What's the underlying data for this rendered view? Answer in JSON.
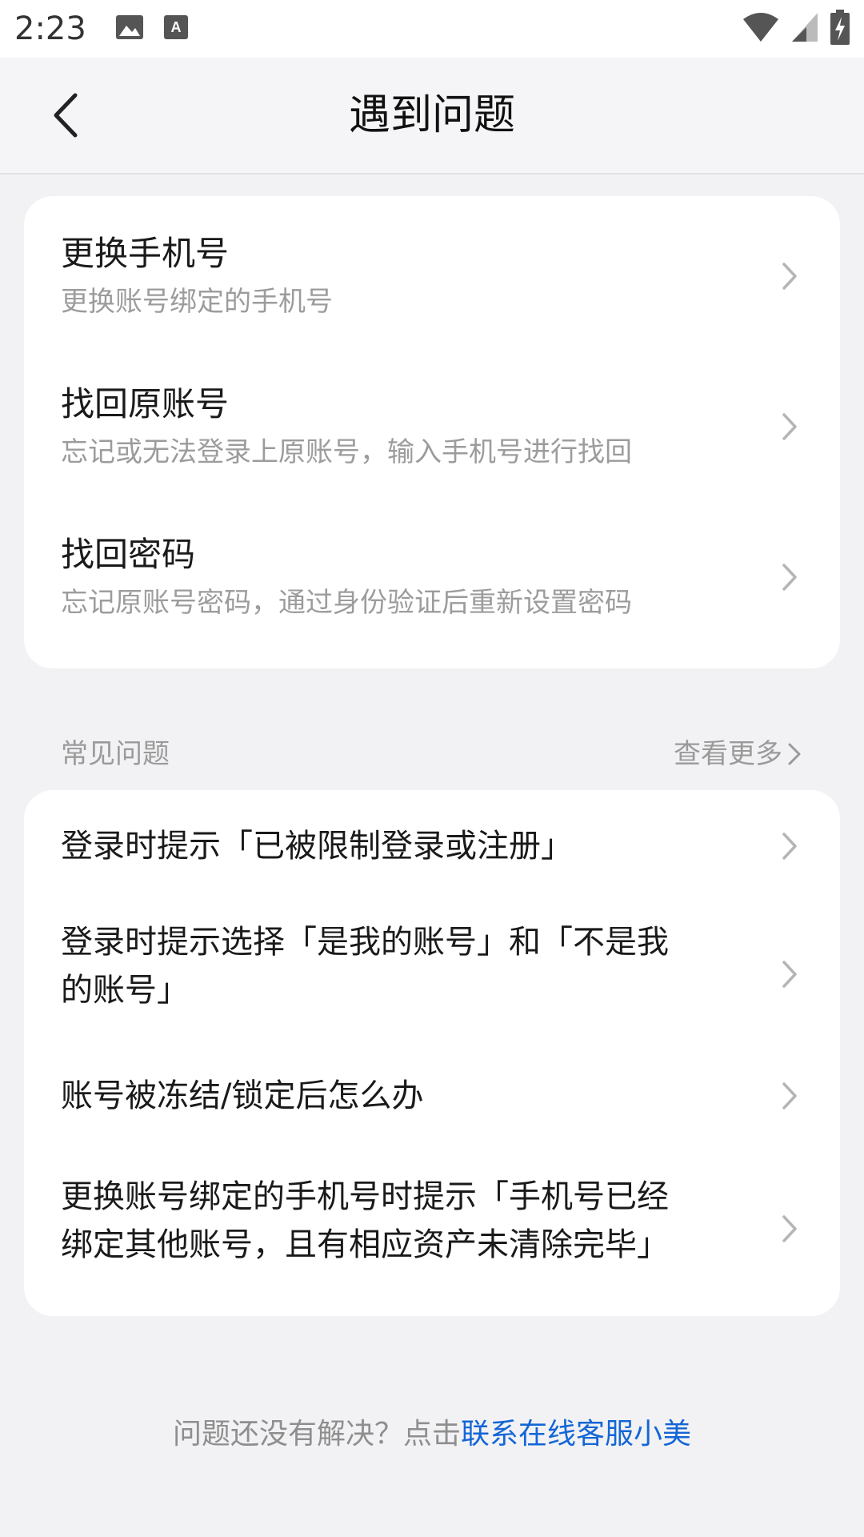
{
  "status_bar": {
    "time": "2:23",
    "icons": [
      "image-icon",
      "text-a-icon",
      "wifi-icon",
      "signal-icon",
      "battery-charging-icon"
    ]
  },
  "app_bar": {
    "back_icon": "chevron-left-icon",
    "title": "遇到问题"
  },
  "top_options": [
    {
      "title": "更换手机号",
      "subtitle": "更换账号绑定的手机号"
    },
    {
      "title": "找回原账号",
      "subtitle": "忘记或无法登录上原账号，输入手机号进行找回"
    },
    {
      "title": "找回密码",
      "subtitle": "忘记原账号密码，通过身份验证后重新设置密码"
    }
  ],
  "faq": {
    "label": "常见问题",
    "see_more": "查看更多",
    "items": [
      {
        "line1": "登录时提示「已被限制登录或注册」",
        "line2": ""
      },
      {
        "line1": "登录时提示选择「是我的账号」和「不是我",
        "line2": "的账号」"
      },
      {
        "line1": "账号被冻结/锁定后怎么办",
        "line2": ""
      },
      {
        "line1": "更换账号绑定的手机号时提示「手机号已经",
        "line2": "绑定其他账号，且有相应资产未清除完毕」"
      }
    ]
  },
  "footer": {
    "text": "问题还没有解决？点击",
    "link": "联系在线客服小美"
  },
  "colors": {
    "background": "#f2f2f4",
    "card": "#ffffff",
    "link": "#1366d6",
    "secondary_text": "#9c9c9c"
  }
}
